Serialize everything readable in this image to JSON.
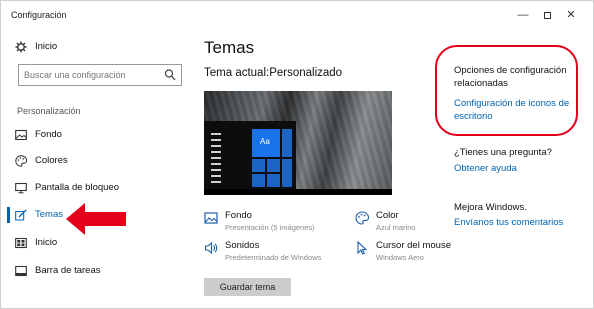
{
  "window": {
    "title": "Configuración",
    "min_glyph": "—",
    "close_glyph": "✕"
  },
  "sidebar": {
    "home_label": "Inicio",
    "search_placeholder": "Buscar una configuración",
    "section_label": "Personalización",
    "items": [
      {
        "label": "Fondo",
        "icon": "image-icon"
      },
      {
        "label": "Colores",
        "icon": "palette-icon"
      },
      {
        "label": "Pantalla de bloqueo",
        "icon": "monitor-icon"
      },
      {
        "label": "Temas",
        "icon": "brush-icon",
        "active": true
      },
      {
        "label": "Inicio",
        "icon": "start-grid-icon"
      },
      {
        "label": "Barra de tareas",
        "icon": "taskbar-icon"
      }
    ]
  },
  "main": {
    "title": "Temas",
    "current_theme": "Tema actual:Personalizado",
    "preview_tile_label": "Aa",
    "settings": [
      {
        "title": "Fondo",
        "subtitle": "Presentación (5 imágenes)",
        "icon": "image-icon"
      },
      {
        "title": "Color",
        "subtitle": "Azul marino",
        "icon": "palette-icon"
      },
      {
        "title": "Sonidos",
        "subtitle": "Predeterminado de Windows",
        "icon": "speaker-icon"
      },
      {
        "title": "Cursor del mouse",
        "subtitle": "Windows Aero",
        "icon": "cursor-icon"
      }
    ],
    "save_button": "Guardar tema"
  },
  "related": {
    "title": "Opciones de configuración relacionadas",
    "link": "Configuración de iconos de escritorio"
  },
  "help": {
    "question": "¿Tienes una pregunta?",
    "link": "Obtener ayuda"
  },
  "feedback": {
    "title": "Mejora Windows.",
    "link": "Envíanos tus comentarios"
  },
  "colors": {
    "accent": "#0063b1",
    "annotation_red": "#e4001b"
  }
}
